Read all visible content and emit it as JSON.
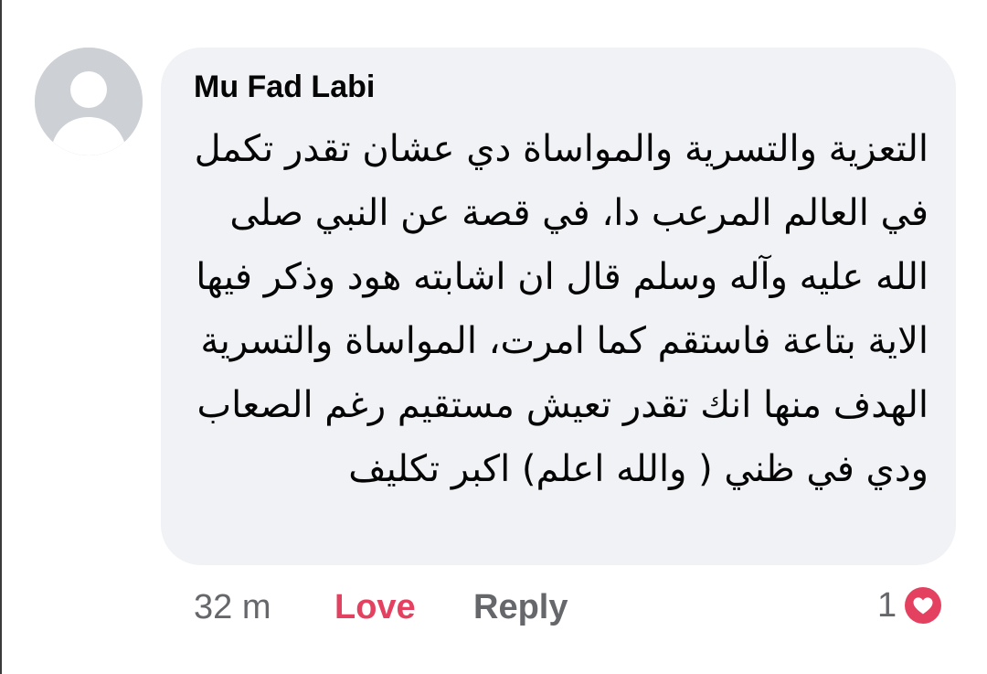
{
  "comment": {
    "author": "Mu Fad Labi",
    "text": "التعزية والتسرية والمواساة دي عشان تقدر تكمل في العالم المرعب دا،  في قصة عن النبي صلى الله عليه وآله وسلم قال ان اشابته هود وذكر فيها الاية بتاعة فاستقم كما امرت، المواساة والتسرية الهدف منها انك تقدر تعيش مستقيم رغم الصعاب ودي في ظني ( والله اعلم)  اكبر تكليف",
    "time": "32 m",
    "love_label": "Love",
    "reply_label": "Reply",
    "reaction_count": "1",
    "reaction_icon": "heart-icon"
  },
  "colors": {
    "bubble": "#f0f2f5",
    "love": "#e4405f",
    "secondary_text": "#65676b",
    "avatar": "#cdd1d6"
  }
}
